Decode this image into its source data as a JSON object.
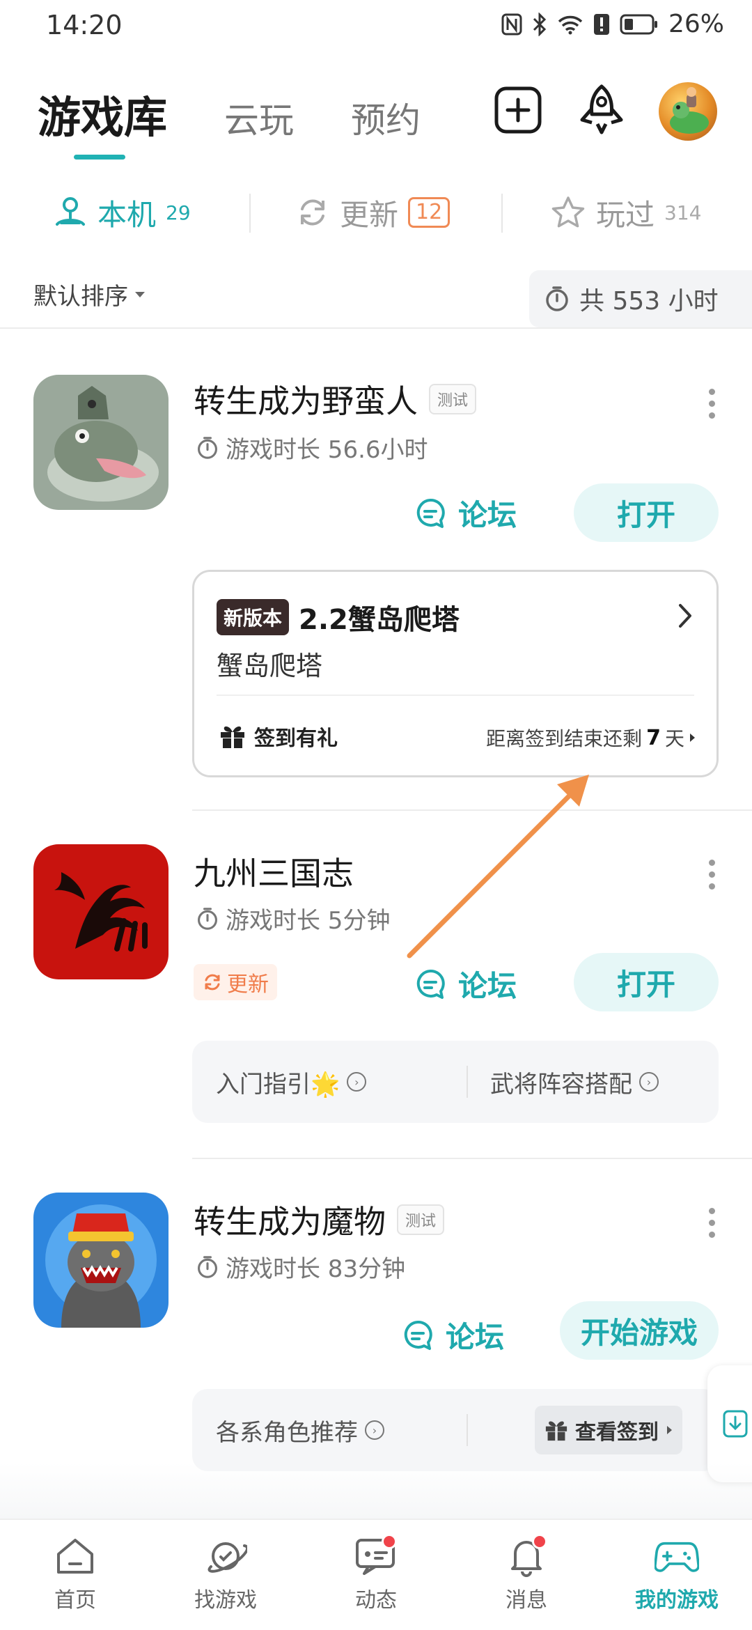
{
  "status_bar": {
    "time": "14:20",
    "battery": "26%"
  },
  "header": {
    "tabs": [
      {
        "label": "游戏库",
        "active": true
      },
      {
        "label": "云玩",
        "active": false
      },
      {
        "label": "预约",
        "active": false
      }
    ],
    "icons": [
      "add-icon",
      "rocket-icon",
      "avatar"
    ]
  },
  "subtabs": [
    {
      "label": "本机",
      "count": "29"
    },
    {
      "label": "更新",
      "count": "12"
    },
    {
      "label": "玩过",
      "count": "314"
    }
  ],
  "sort": {
    "label": "默认排序"
  },
  "total_hours": "共 553 小时",
  "games": [
    {
      "title": "转生成为野蛮人",
      "tag": "测试",
      "playtime": "游戏时长 56.6小时",
      "forum": "论坛",
      "action": "打开",
      "version_card": {
        "badge": "新版本",
        "title": "2.2蟹岛爬塔",
        "subtitle": "蟹岛爬塔",
        "checkin": "签到有礼",
        "countdown_prefix": "距离签到结束还剩",
        "countdown_value": "7",
        "countdown_unit": "天"
      }
    },
    {
      "title": "九州三国志",
      "playtime": "游戏时长 5分钟",
      "update_chip": "更新",
      "forum": "论坛",
      "action": "打开",
      "links": [
        "入门指引🌟",
        "武将阵容搭配"
      ]
    },
    {
      "title": "转生成为魔物",
      "tag": "测试",
      "playtime": "游戏时长 83分钟",
      "forum": "论坛",
      "action": "开始游戏",
      "links": [
        "各系角色推荐"
      ],
      "checkin_button": "查看签到"
    }
  ],
  "bottom_nav": [
    {
      "label": "首页",
      "icon": "home-icon"
    },
    {
      "label": "找游戏",
      "icon": "planet-icon"
    },
    {
      "label": "动态",
      "icon": "chat-icon",
      "dot": true
    },
    {
      "label": "消息",
      "icon": "bell-icon",
      "dot": true
    },
    {
      "label": "我的游戏",
      "icon": "gamepad-icon",
      "active": true
    }
  ],
  "colors": {
    "accent": "#1fa9ad",
    "update": "#f07c4a",
    "annotation_arrow": "#f0914a"
  }
}
